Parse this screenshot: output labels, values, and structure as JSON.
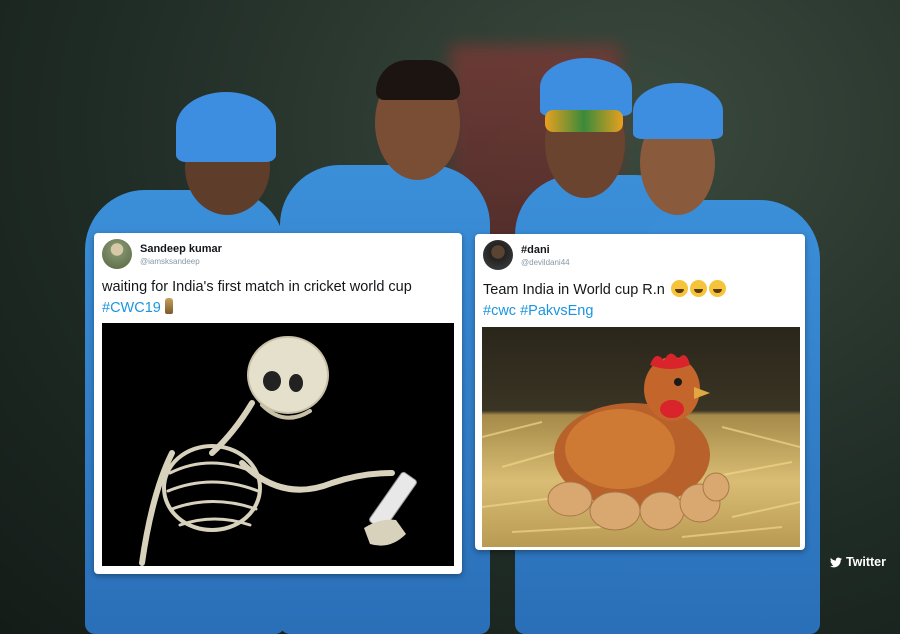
{
  "watermark": {
    "brand": "Twitter",
    "icon": "twitter-bird-icon"
  },
  "tweets": [
    {
      "name": "Sandeep kumar",
      "handle": "@iamsksandeep",
      "text_main": "waiting for India's first match in cricket world cup",
      "hashtags": [
        "#CWC19"
      ],
      "emoji": [
        "trophy-icon"
      ],
      "image": "skeleton-using-phone"
    },
    {
      "name": "#dani",
      "handle": "@devildani44",
      "text_main": "Team India in World cup R.n",
      "hashtags": [
        "#cwc",
        "#PakvsEng"
      ],
      "emoji": [
        "grinning-sweat-icon",
        "tears-of-joy-icon",
        "grinning-sweat-icon"
      ],
      "image": "hen-sitting-on-eggs"
    }
  ],
  "colors": {
    "hashtag": "#1b95e0",
    "card_bg": "#ffffff",
    "jersey": "#2a6fb8"
  }
}
